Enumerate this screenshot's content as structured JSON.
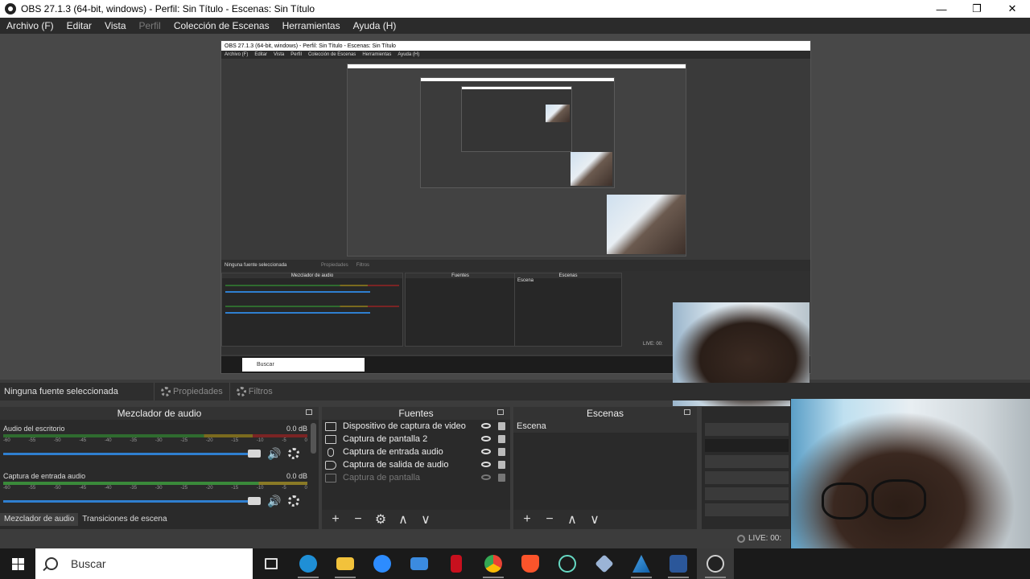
{
  "window": {
    "title": "OBS 27.1.3 (64-bit, windows) - Perfil: Sin Título - Escenas: Sin Título",
    "minimize": "—",
    "restore": "❐",
    "close": "✕"
  },
  "menu": {
    "items": [
      "Archivo (F)",
      "Editar",
      "Vista",
      "Perfil",
      "Colección de Escenas",
      "Herramientas",
      "Ayuda (H)"
    ]
  },
  "nested": {
    "title": "OBS 27.1.3 (64-bit, windows) - Perfil: Sin Título - Escenas: Sin Título",
    "menu": [
      "Archivo (F)",
      "Editar",
      "Vista",
      "Perfil",
      "Colección de Escenas",
      "Herramientas",
      "Ayuda (H)"
    ],
    "no_source": "Ninguna fuente seleccionada",
    "properties": "Propiedades",
    "filters": "Filtros",
    "mixer_title": "Mezclador de audio",
    "sources_title": "Fuentes",
    "scenes_title": "Escenas",
    "scene": "Escena",
    "search": "Buscar",
    "live": "LIVE: 00:"
  },
  "context_bar": {
    "no_source": "Ninguna fuente seleccionada",
    "properties": "Propiedades",
    "filters": "Filtros"
  },
  "mixer": {
    "title": "Mezclador de audio",
    "channels": [
      {
        "name": "Audio del escritorio",
        "db": "0.0 dB"
      },
      {
        "name": "Captura de entrada audio",
        "db": "0.0 dB"
      }
    ],
    "ticks": [
      "-60",
      "-55",
      "-50",
      "-45",
      "-40",
      "-35",
      "-30",
      "-25",
      "-20",
      "-15",
      "-10",
      "-5",
      "0"
    ],
    "tabs": [
      "Mezclador de audio",
      "Transiciones de escena"
    ]
  },
  "sources": {
    "title": "Fuentes",
    "items": [
      {
        "label": "Dispositivo de captura de video",
        "icon": "camera-icon"
      },
      {
        "label": "Captura de pantalla 2",
        "icon": "monitor-icon"
      },
      {
        "label": "Captura de entrada audio",
        "icon": "microphone-icon"
      },
      {
        "label": "Captura de salida de audio",
        "icon": "speaker-icon"
      },
      {
        "label": "Captura de pantalla",
        "icon": "monitor-icon",
        "hidden": true
      }
    ],
    "toolbar": [
      "+",
      "−",
      "⚙",
      "∧",
      "∨"
    ]
  },
  "scenes": {
    "title": "Escenas",
    "items": [
      "Escena"
    ],
    "toolbar": [
      "+",
      "−",
      "∧",
      "∨"
    ]
  },
  "status": {
    "live": "LIVE: 00:"
  },
  "taskbar": {
    "search": "Buscar",
    "apps": [
      {
        "name": "task-view-icon",
        "color": "#1a1a1a"
      },
      {
        "name": "edge-icon",
        "color": "#1f8fd6"
      },
      {
        "name": "file-explorer-icon",
        "color": "#f2c23b"
      },
      {
        "name": "zoom-icon",
        "color": "#2d8cff"
      },
      {
        "name": "mail-icon",
        "color": "#3b8be0"
      },
      {
        "name": "netflix-icon",
        "color": "#c8101e"
      },
      {
        "name": "chrome-icon",
        "color": "#34a853"
      },
      {
        "name": "brave-icon",
        "color": "#fb542b"
      },
      {
        "name": "atom-icon",
        "color": "#66d9c3"
      },
      {
        "name": "virtualbox-icon",
        "color": "#9bb4d6"
      },
      {
        "name": "azure-icon",
        "color": "#4aa3e8"
      },
      {
        "name": "word-icon",
        "color": "#2b579a"
      },
      {
        "name": "obs-icon",
        "color": "#cfcfcf"
      }
    ]
  }
}
